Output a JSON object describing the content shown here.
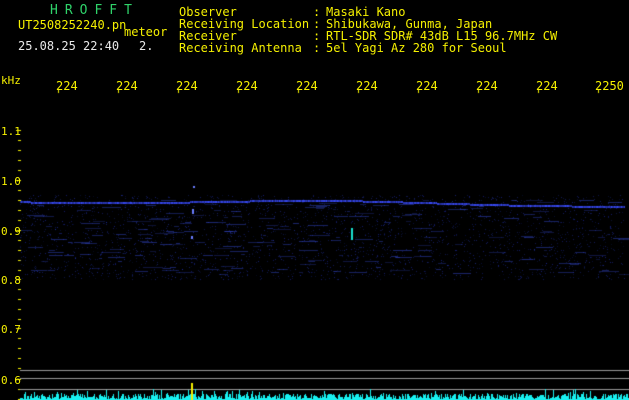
{
  "header": {
    "brand": "HROFFT",
    "filename": "UT2508252240.pn",
    "mode": "meteor",
    "datetime": "25.08.25 22:40",
    "count": "2.",
    "fields": [
      {
        "label": "Observer",
        "colon": ":",
        "value": "Masaki Kano"
      },
      {
        "label": "Receiving Location",
        "colon": ":",
        "value": "Shibukawa, Gunma, Japan"
      },
      {
        "label": "Receiver",
        "colon": ":",
        "value": "RTL-SDR SDR# 43dB L15 96.7MHz CW"
      },
      {
        "label": "Receiving Antenna",
        "colon": ":",
        "value": "5el Yagi Az 280 for Seoul"
      }
    ]
  },
  "time_axis": {
    "labels": [
      "224",
      "224",
      "224",
      "224",
      "224",
      "224",
      "224",
      "224",
      "224",
      "2250"
    ]
  },
  "freq_axis": {
    "unit": "kHz",
    "labels": [
      "1.1",
      "1.0",
      "0.9",
      "0.8",
      "0.7",
      "0.6"
    ]
  },
  "colors": {
    "background": "#000000",
    "text_primary": "#f5f000",
    "brand": "#2fd36a",
    "signal_line": "#3a4cff",
    "echo": "#19e0d0",
    "noise": "#18f0f0"
  }
}
